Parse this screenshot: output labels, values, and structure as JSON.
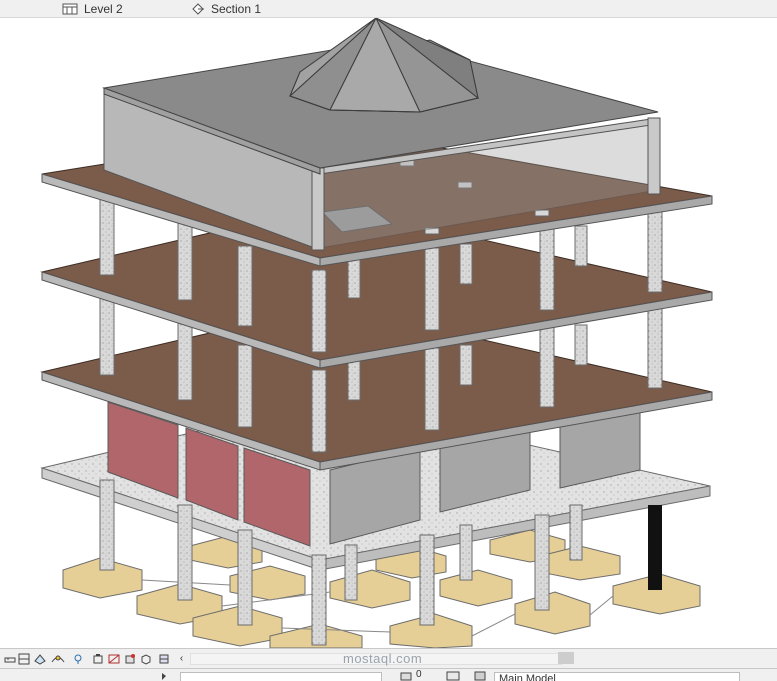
{
  "tabs": [
    {
      "label": "Level 2",
      "icon": "floor-plan-icon"
    },
    {
      "label": "Section 1",
      "icon": "section-icon"
    }
  ],
  "view_controls": {
    "icons": [
      "scale-icon",
      "detail-level-icon",
      "visual-style-icon",
      "sun-path-icon",
      "shadows-icon",
      "crop-region-icon",
      "show-crop-icon",
      "temporary-hide-icon",
      "reveal-hidden-icon",
      "collapse-arrow-icon"
    ]
  },
  "watermark": "mostaql.com",
  "status_bar": {
    "workset_value": "0",
    "model_selector": "Main Model"
  },
  "colors": {
    "slab_top": "#7b5b4a",
    "roof": "#8a8a8a",
    "parapet": "#b8b8b8",
    "concrete": "#d8d8d8",
    "footing": "#e6cf96",
    "red_wall": "#b0666a",
    "grey_wall": "#a6a6a6"
  }
}
